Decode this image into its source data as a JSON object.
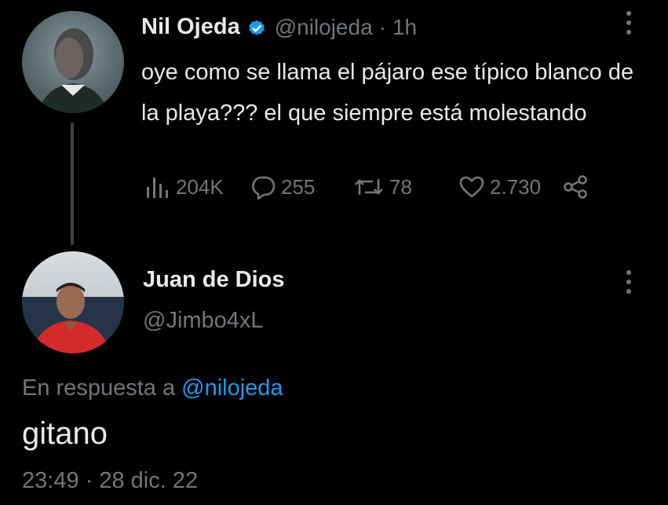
{
  "tweet": {
    "author_name": "Nil Ojeda",
    "author_handle": "@nilojeda",
    "separator": "·",
    "time": "1h",
    "text": "oye como se llama el pájaro ese típico blanco de la playa??? el que siempre está molestando",
    "stats": {
      "views": "204K",
      "replies": "255",
      "retweets": "78",
      "likes": "2.730"
    }
  },
  "reply": {
    "author_name": "Juan de Dios",
    "author_handle": "@Jimbo4xL",
    "in_reply_prefix": "En respuesta a",
    "in_reply_mention": "@nilojeda",
    "text": "gitano",
    "timestamp": "23:49 · 28 dic. 22"
  },
  "icons": {
    "verified": "verified-badge-icon",
    "views": "analytics-icon",
    "replies": "reply-icon",
    "retweets": "retweet-icon",
    "likes": "heart-icon",
    "share": "share-icon",
    "more": "more-vertical-icon"
  },
  "colors": {
    "background": "#000000",
    "text_primary": "#e7e9ea",
    "text_secondary": "#71767b",
    "accent": "#1d9bf0",
    "thread_line": "#3e4144"
  }
}
